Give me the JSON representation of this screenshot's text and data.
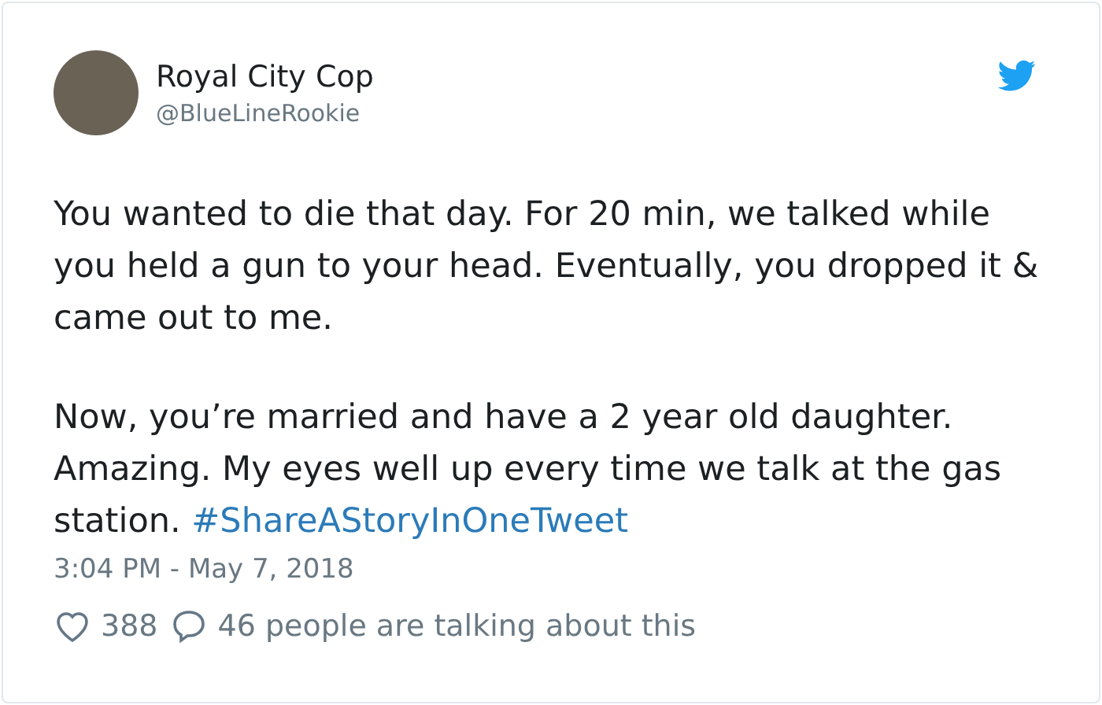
{
  "author": {
    "name": "Royal City Cop",
    "handle": "@BlueLineRookie"
  },
  "paragraphs": [
    {
      "text": "You wanted to die that day. For 20 min, we talked while you held a gun to your head. Eventually, you dropped it & came out to me."
    },
    {
      "text": "Now, you’re married and have a 2 year old daughter. Amazing. My eyes well up every time we talk at the gas station. ",
      "hashtag": "#ShareAStoryInOneTweet"
    }
  ],
  "timestamp": "3:04 PM - May 7, 2018",
  "likes": "388",
  "conversation": "46 people are talking about this"
}
